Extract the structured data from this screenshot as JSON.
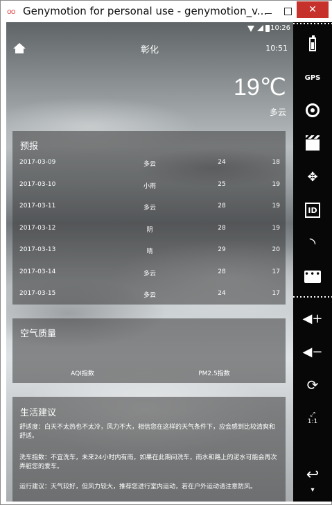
{
  "window": {
    "title": "Genymotion for personal use - genymotion_v...",
    "app_icon": "oo",
    "close_label": "✕"
  },
  "statusbar": {
    "time": "10:26"
  },
  "header": {
    "city": "彰化",
    "update_time": "10:51"
  },
  "now": {
    "temp": "19℃",
    "condition": "多云"
  },
  "forecast": {
    "title": "预报",
    "rows": [
      {
        "date": "2017-03-09",
        "cond": "多云",
        "max": "24",
        "min": "18"
      },
      {
        "date": "2017-03-10",
        "cond": "小雨",
        "max": "25",
        "min": "19"
      },
      {
        "date": "2017-03-11",
        "cond": "多云",
        "max": "28",
        "min": "19"
      },
      {
        "date": "2017-03-12",
        "cond": "阴",
        "max": "28",
        "min": "19"
      },
      {
        "date": "2017-03-13",
        "cond": "晴",
        "max": "29",
        "min": "20"
      },
      {
        "date": "2017-03-14",
        "cond": "多云",
        "max": "28",
        "min": "17"
      },
      {
        "date": "2017-03-15",
        "cond": "多云",
        "max": "24",
        "min": "17"
      }
    ]
  },
  "aqi": {
    "title": "空气质量",
    "aqi_label": "AQI指数",
    "pm25_label": "PM2.5指数"
  },
  "advice": {
    "title": "生活建议",
    "comfort": "舒适度：白天不太热也不太冷，风力不大，相信您在这样的天气条件下，应会感到比较清爽和舒适。",
    "carwash": "洗车指数：不宜洗车，未来24小时内有雨，如果在此期间洗车，雨水和路上的泥水可能会再次弄脏您的爱车。",
    "sport": "运行建议：天气较好，但风力较大，推荐您进行室内运动，若在户外运动请注意防风。"
  },
  "sidebar": {
    "gps": "GPS",
    "id": "ID",
    "dpad": "✥",
    "rss": "◝",
    "sms": "•••",
    "vol_up": "◀+",
    "vol_down": "◀−",
    "rotate": "⟳",
    "scale_top": "⤢",
    "scale_text": "1:1",
    "back": "↩",
    "more": "▾"
  }
}
